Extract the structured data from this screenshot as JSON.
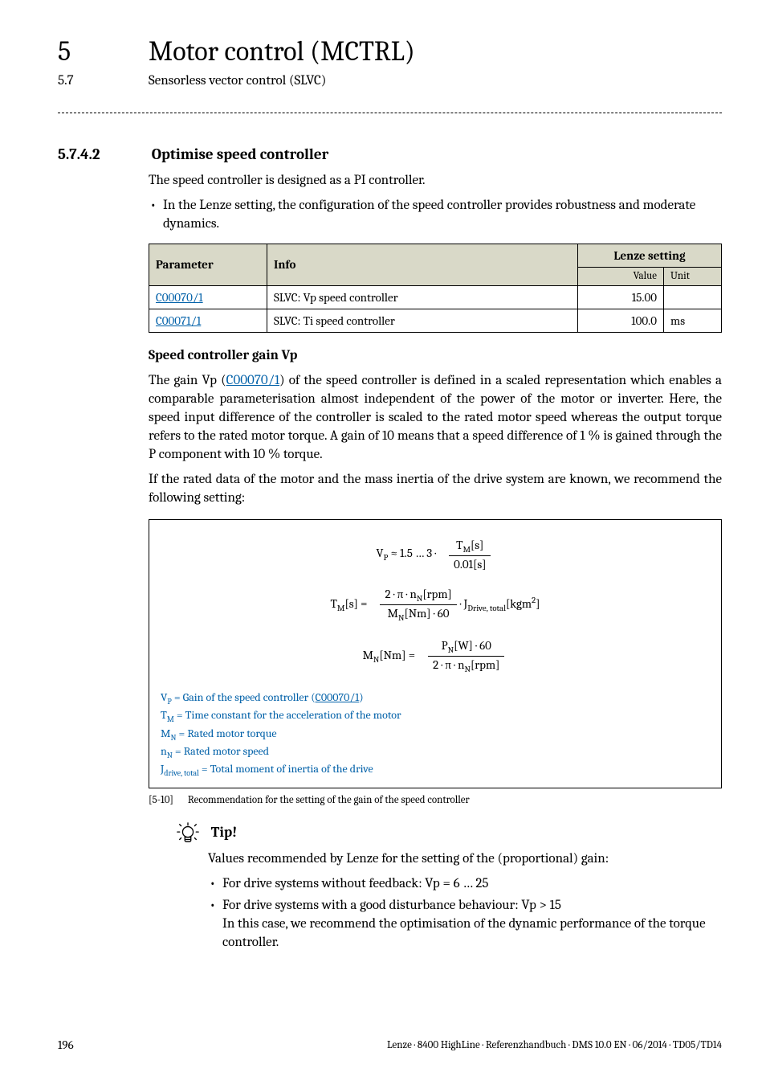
{
  "chapter": {
    "num": "5",
    "title": "Motor control (MCTRL)"
  },
  "section": {
    "num": "5.7",
    "title": "Sensorless vector control (SLVC)"
  },
  "heading": {
    "num": "5.7.4.2",
    "title": "Optimise speed controller"
  },
  "intro": "The speed controller is designed as a PI controller.",
  "intro_bullets": [
    "In the Lenze setting, the configuration of the speed controller provides robustness and moderate dynamics."
  ],
  "table": {
    "head": {
      "param": "Parameter",
      "info": "Info",
      "setting": "Lenze setting",
      "value": "Value",
      "unit": "Unit"
    },
    "rows": [
      {
        "param": "C00070/1",
        "info": "SLVC: Vp speed controller",
        "value": "15.00",
        "unit": ""
      },
      {
        "param": "C00071/1",
        "info": "SLVC: Ti speed controller",
        "value": "100.0",
        "unit": "ms"
      }
    ]
  },
  "vp_sub": "Speed controller gain Vp",
  "vp_para1_a": "The gain Vp (",
  "vp_para1_link": "C00070/1",
  "vp_para1_b": ") of the speed controller is defined in a scaled representation which enables a comparable parameterisation almost independent of the power of the motor or inverter. Here, the speed input difference of the controller is scaled to the rated motor speed whereas the output torque refers to the rated motor torque. A gain of 10 means that a speed difference of 1 % is gained through the P component with 10 % torque.",
  "vp_para2": "If the rated data of the motor and the mass inertia of the drive system are known, we recommend the following setting:",
  "eq": {
    "e1": {
      "lhs": "V",
      "lhs_sub": "P",
      "approx": "≈ 1.5 … 3 ·",
      "num": "T",
      "num_sub": "M",
      "num_unit": "[s]",
      "den": "0.01[s]"
    },
    "e2": {
      "lhs": "T",
      "lhs_sub": "M",
      "lhs_unit": "[s]",
      "eq": "=",
      "num": "2 · π · n",
      "num_sub": "N",
      "num_unit": "[rpm]",
      "den": "M",
      "den_sub": "N",
      "den_unit": "[Nm] · 60",
      "tail": " · J",
      "tail_sub": "Drive, total",
      "tail_unit": "[kgm",
      "tail_sup": "2",
      "tail_close": "]"
    },
    "e3": {
      "lhs": "M",
      "lhs_sub": "N",
      "lhs_unit": "[Nm]",
      "eq": "=",
      "num": "P",
      "num_sub": "N",
      "num_unit": "[W] · 60",
      "den": "2 · π · n",
      "den_sub": "N",
      "den_unit": "[rpm]"
    }
  },
  "legend": {
    "l1_a": "V",
    "l1_sub": "P",
    "l1_b": " = Gain of the speed controller (",
    "l1_link": "C00070/1",
    "l1_c": ")",
    "l2_a": "T",
    "l2_sub": "M",
    "l2_b": " = Time constant for the acceleration of the motor",
    "l3_a": "M",
    "l3_sub": "N",
    "l3_b": " = Rated motor torque",
    "l4_a": "n",
    "l4_sub": "N",
    "l4_b": " = Rated motor speed",
    "l5_a": "J",
    "l5_sub": "drive, total",
    "l5_b": " = Total moment of inertia of the drive"
  },
  "fig": {
    "tag": "[5-10]",
    "caption": "Recommendation for the setting of the gain of the speed controller"
  },
  "tip": {
    "title": "Tip!",
    "lead": "Values recommended by Lenze for the setting of the (proportional) gain:",
    "bullets": [
      "For drive systems without feedback: Vp = 6 … 25",
      "For drive systems with a good disturbance behaviour: Vp > 15\nIn this case, we recommend the optimisation of the dynamic performance of the torque controller."
    ]
  },
  "footer": {
    "page": "196",
    "text": "Lenze · 8400 HighLine · Referenzhandbuch · DMS 10.0 EN · 06/2014 · TD05/TD14"
  }
}
